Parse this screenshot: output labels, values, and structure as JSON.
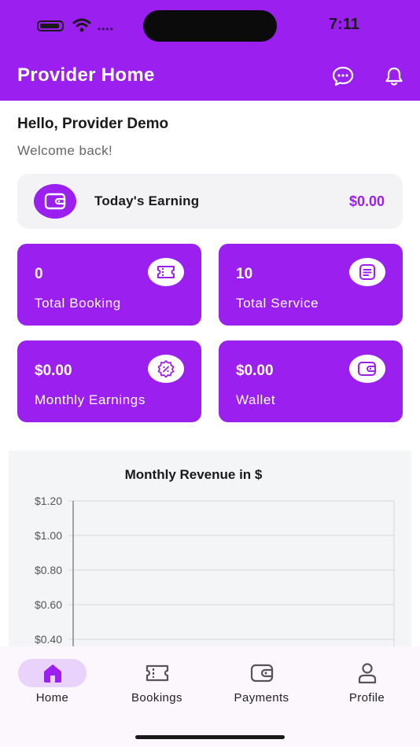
{
  "status_bar": {
    "time": "7:11"
  },
  "app_bar": {
    "title": "Provider Home",
    "chat_icon": "chat-bubble-icon",
    "notification_icon": "bell-icon"
  },
  "greeting": {
    "hello": "Hello, Provider Demo",
    "welcome": "Welcome back!"
  },
  "today_earning": {
    "label": "Today's Earning",
    "value": "$0.00",
    "icon": "wallet-icon"
  },
  "stats": [
    {
      "value": "0",
      "label": "Total Booking",
      "icon": "ticket-icon"
    },
    {
      "value": "10",
      "label": "Total Service",
      "icon": "list-document-icon"
    },
    {
      "value": "$0.00",
      "label": "Monthly Earnings",
      "icon": "discount-badge-icon"
    },
    {
      "value": "$0.00",
      "label": "Wallet",
      "icon": "wallet-icon"
    }
  ],
  "chart_data": {
    "type": "line",
    "title": "Monthly Revenue in $",
    "y_ticks": [
      "$1.20",
      "$1.00",
      "$0.80",
      "$0.60",
      "$0.40"
    ],
    "ylim": [
      0.4,
      1.2
    ],
    "grid": true,
    "series": []
  },
  "bottom_nav": {
    "items": [
      {
        "label": "Home",
        "icon": "home-icon",
        "active": true
      },
      {
        "label": "Bookings",
        "icon": "ticket-icon",
        "active": false
      },
      {
        "label": "Payments",
        "icon": "wallet-icon",
        "active": false
      },
      {
        "label": "Profile",
        "icon": "person-icon",
        "active": false
      }
    ]
  },
  "colors": {
    "primary": "#9b1fef",
    "active_pill": "#ead3fb",
    "card_bg": "#f3f3f5"
  }
}
